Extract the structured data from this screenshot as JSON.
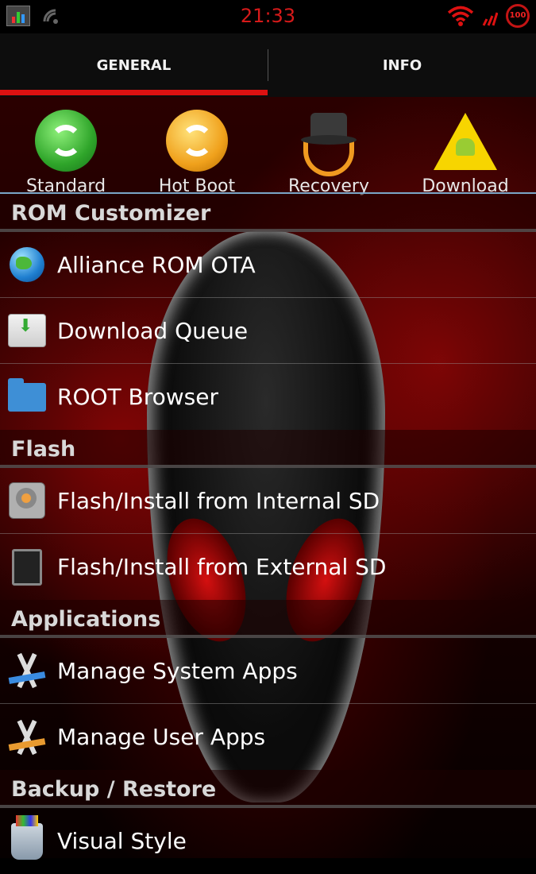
{
  "status_bar": {
    "time": "21:33",
    "battery": "100"
  },
  "tabs": [
    {
      "label": "GENERAL",
      "selected": true
    },
    {
      "label": "INFO",
      "selected": false
    }
  ],
  "reboot_options": [
    {
      "label": "Standard",
      "icon": "green-refresh-icon"
    },
    {
      "label": "Hot Boot",
      "icon": "orange-refresh-icon"
    },
    {
      "label": "Recovery",
      "icon": "hat-recovery-icon"
    },
    {
      "label": "Download",
      "icon": "warning-android-icon"
    }
  ],
  "sections": [
    {
      "title": "ROM Customizer",
      "items": [
        {
          "label": "Alliance ROM OTA",
          "icon": "globe-icon"
        },
        {
          "label": "Download Queue",
          "icon": "download-drive-icon"
        },
        {
          "label": "ROOT Browser",
          "icon": "folder-icon"
        }
      ]
    },
    {
      "title": "Flash",
      "items": [
        {
          "label": "Flash/Install from Internal SD",
          "icon": "hard-drive-icon"
        },
        {
          "label": "Flash/Install from External SD",
          "icon": "sd-card-icon"
        }
      ]
    },
    {
      "title": "Applications",
      "items": [
        {
          "label": "Manage System Apps",
          "icon": "app-store-icon"
        },
        {
          "label": "Manage User Apps",
          "icon": "app-store-icon"
        }
      ]
    },
    {
      "title": "Backup / Restore",
      "items": [
        {
          "label": "Visual Style",
          "icon": "paint-brushes-icon"
        }
      ]
    }
  ],
  "colors": {
    "accent": "#d11111",
    "clock": "#d61a1a",
    "divider": "#7aa6c8"
  }
}
